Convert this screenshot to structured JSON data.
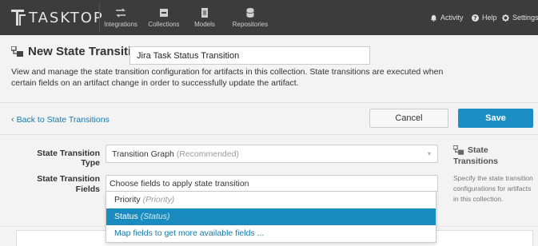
{
  "app": {
    "logo_text": "TASKTOP",
    "nav": [
      {
        "label": "Integrations",
        "icon": "arrows-icon"
      },
      {
        "label": "Collections",
        "icon": "inbox-icon"
      },
      {
        "label": "Models",
        "icon": "document-icon"
      },
      {
        "label": "Repositories",
        "icon": "database-icon"
      }
    ],
    "right_nav": [
      {
        "label": "Activity",
        "icon": "bell-icon"
      },
      {
        "label": "Help",
        "icon": "help-icon"
      },
      {
        "label": "Settings",
        "icon": "gear-icon"
      }
    ]
  },
  "header": {
    "title": "New State Transition",
    "name_value": "Jira Task Status Transition",
    "description": "View and manage the state transition configuration for artifacts in this collection. State transitions are executed when certain fields on an artifact change in order to successfully update the artifact."
  },
  "actions": {
    "back_label": "Back to State Transitions",
    "cancel_label": "Cancel",
    "save_label": "Save"
  },
  "form": {
    "type_label": "State Transition Type",
    "type_value": "Transition Graph",
    "type_note": "(Recommended)",
    "fields_label_line1": "State Transition",
    "fields_label_line2": "Fields",
    "fields_placeholder": "Choose fields to apply state transition",
    "options": [
      {
        "label": "Priority",
        "sub": "(Priority)",
        "selected": false
      },
      {
        "label": "Status",
        "sub": "(Status)",
        "selected": true
      }
    ],
    "map_link": "Map fields to get more available fields ..."
  },
  "sidebar": {
    "title_line1": "State",
    "title_line2": "Transitions",
    "text": "Specify the state transition configurations for artifacts in this collection."
  },
  "colors": {
    "nav_bg": "#3c3c3c",
    "accent": "#1d8ec4",
    "selected_option": "#1a8bbf",
    "link": "#1a78a8"
  }
}
